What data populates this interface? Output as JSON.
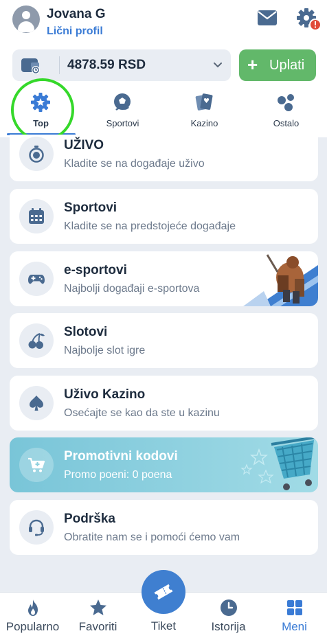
{
  "header": {
    "user_name": "Jovana G",
    "profile_link": "Lični profil"
  },
  "balance": {
    "amount": "4878.59 RSD",
    "deposit_label": "Uplati"
  },
  "tabs": [
    {
      "label": "Top",
      "icon": "gear-star-icon",
      "active": true
    },
    {
      "label": "Sportovi",
      "icon": "ball-icon",
      "active": false
    },
    {
      "label": "Kazino",
      "icon": "cards-icon",
      "active": false
    },
    {
      "label": "Ostalo",
      "icon": "dots-icon",
      "active": false
    }
  ],
  "menu": [
    {
      "title": "UŽIVO",
      "subtitle": "Kladite se na događaje uživo",
      "icon": "stopwatch-icon"
    },
    {
      "title": "Sportovi",
      "subtitle": "Kladite se na predstojeće događaje",
      "icon": "calendar-icon"
    },
    {
      "title": "e-sportovi",
      "subtitle": "Najbolji događaji e-sportova",
      "icon": "gamepad-icon"
    },
    {
      "title": "Slotovi",
      "subtitle": "Najbolje slot igre",
      "icon": "cherries-icon"
    },
    {
      "title": "Uživo Kazino",
      "subtitle": "Osećajte se kao da ste u kazinu",
      "icon": "spade-icon"
    },
    {
      "title": "Promotivni kodovi",
      "subtitle": "Promo poeni: 0 poena",
      "icon": "cart-icon"
    },
    {
      "title": "Podrška",
      "subtitle": "Obratite nam se i pomoći ćemo vam",
      "icon": "headset-icon"
    }
  ],
  "bottom_nav": {
    "popular": "Popularno",
    "favorites": "Favoriti",
    "ticket": "Tiket",
    "history": "Istorija",
    "menu": "Meni"
  },
  "colors": {
    "accent": "#3a7bd5",
    "deposit": "#62b86a",
    "promo": "#79c5d8",
    "alert": "#e04a3a",
    "highlight": "#35d82a"
  }
}
